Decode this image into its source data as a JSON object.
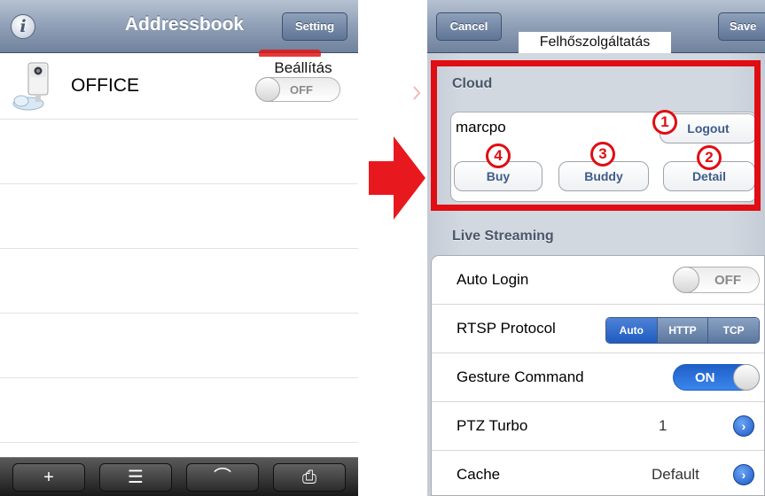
{
  "left_screen": {
    "title": "Addressbook",
    "info_icon": "i",
    "setting_button": "Setting",
    "callout": "Beállítás",
    "entries": [
      {
        "name": "OFFICE",
        "toggle": "OFF",
        "icon": "camera-icon"
      }
    ],
    "tabbar": [
      {
        "icon": "plus-icon",
        "glyph": "+"
      },
      {
        "icon": "edit-list-icon",
        "glyph": "☰"
      },
      {
        "icon": "chart-icon",
        "glyph": "⌒"
      },
      {
        "icon": "print-icon",
        "glyph": "⎙"
      }
    ]
  },
  "right_screen": {
    "cancel_button": "Cancel",
    "save_button": "Save",
    "callout": "Felhőszolgáltatás",
    "cloud_section": {
      "label": "Cloud",
      "username": "marcpo",
      "logout_button": "Logout",
      "buy_button": "Buy",
      "buddy_button": "Buddy",
      "detail_button": "Detail",
      "markers": [
        "1",
        "2",
        "3",
        "4"
      ]
    },
    "live_streaming": {
      "label": "Live Streaming",
      "auto_login": {
        "label": "Auto Login",
        "toggle": "OFF"
      },
      "rtsp_protocol": {
        "label": "RTSP Protocol",
        "options": [
          "Auto",
          "HTTP",
          "TCP"
        ],
        "selected": "Auto"
      },
      "gesture_command": {
        "label": "Gesture Command",
        "toggle": "ON"
      },
      "ptz_turbo": {
        "label": "PTZ Turbo",
        "value": "1"
      },
      "cache": {
        "label": "Cache",
        "value": "Default"
      }
    }
  },
  "colors": {
    "annotation_red": "#e00d12",
    "nav_blue": "#8f9fb6",
    "toggle_on_blue": "#1e5fc8"
  }
}
